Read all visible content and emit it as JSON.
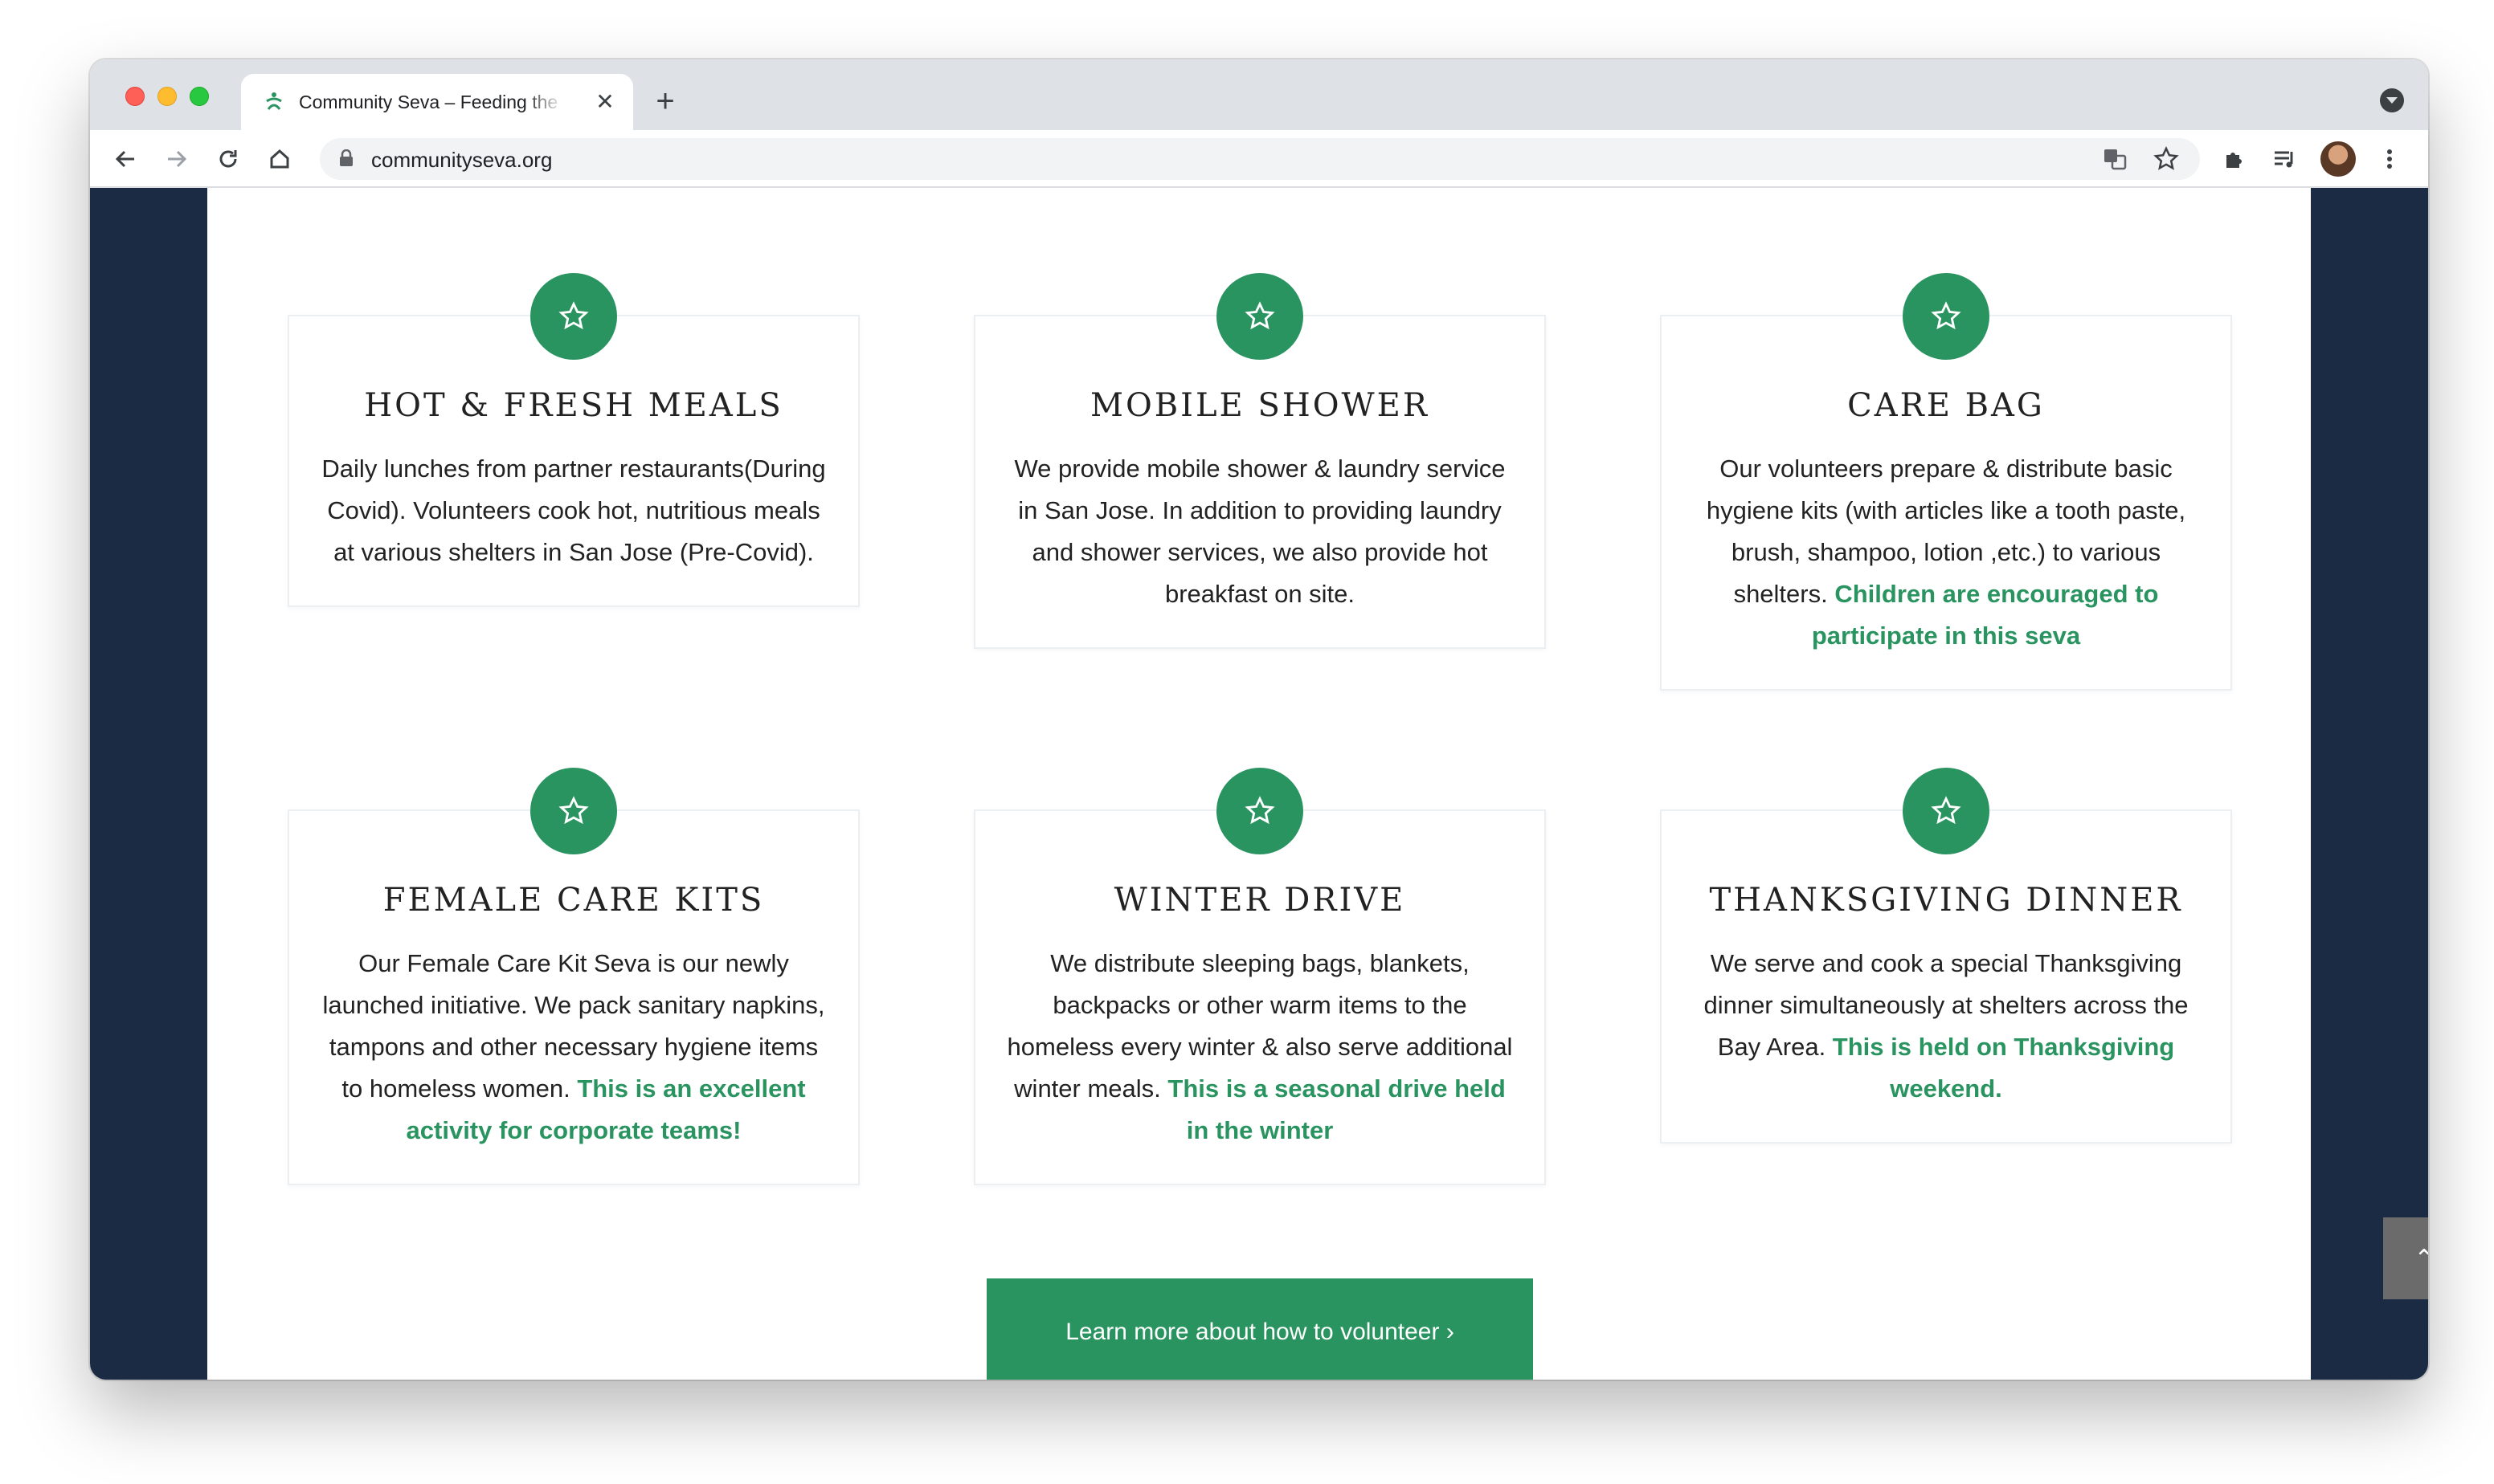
{
  "browser": {
    "tab_title": "Community Seva – Feeding the Homeless",
    "tab_close": "✕",
    "new_tab": "+",
    "url": "communityseva.org",
    "icons": [
      "back-icon",
      "forward-icon",
      "reload-icon",
      "home-icon",
      "lock-icon",
      "translate-icon",
      "bookmark-star-icon",
      "extensions-icon",
      "reading-list-icon",
      "avatar",
      "menu-icon"
    ]
  },
  "services": [
    {
      "title": "HOT & FRESH MEALS",
      "text": "Daily lunches from partner restaurants(During Covid). Volunteers cook hot, nutritious meals at various shelters in San Jose (Pre-Covid).",
      "highlight": ""
    },
    {
      "title": "MOBILE SHOWER",
      "text": "We provide mobile shower & laundry service in San Jose. In addition to providing laundry and shower services, we also provide hot breakfast on site.",
      "highlight": ""
    },
    {
      "title": "CARE BAG",
      "text": "Our volunteers prepare & distribute basic hygiene kits (with articles like a tooth paste, brush, shampoo, lotion ,etc.) to various shelters. ",
      "highlight": "Children are encouraged to participate in this seva"
    },
    {
      "title": "FEMALE CARE KITS",
      "text": "Our Female Care Kit Seva is our newly launched initiative. We pack sanitary napkins, tampons and other necessary hygiene items to homeless women. ",
      "highlight": "This is an excellent activity for corporate teams!"
    },
    {
      "title": "WINTER DRIVE",
      "text": "We distribute sleeping bags, blankets, backpacks or other warm items to the homeless every winter & also serve additional winter meals. ",
      "highlight": "This is a seasonal drive held in the winter"
    },
    {
      "title": "THANKSGIVING DINNER",
      "text": "We serve and cook a special Thanksgiving dinner simultaneously at shelters across the Bay Area. ",
      "highlight": "This is held on Thanksgiving weekend."
    }
  ],
  "cta_label": "Learn more about how to volunteer ›",
  "scroll_top_label": "⌃",
  "colors": {
    "accent_green": "#2a9461",
    "side_navy": "#1c2b44",
    "text": "#222222"
  }
}
